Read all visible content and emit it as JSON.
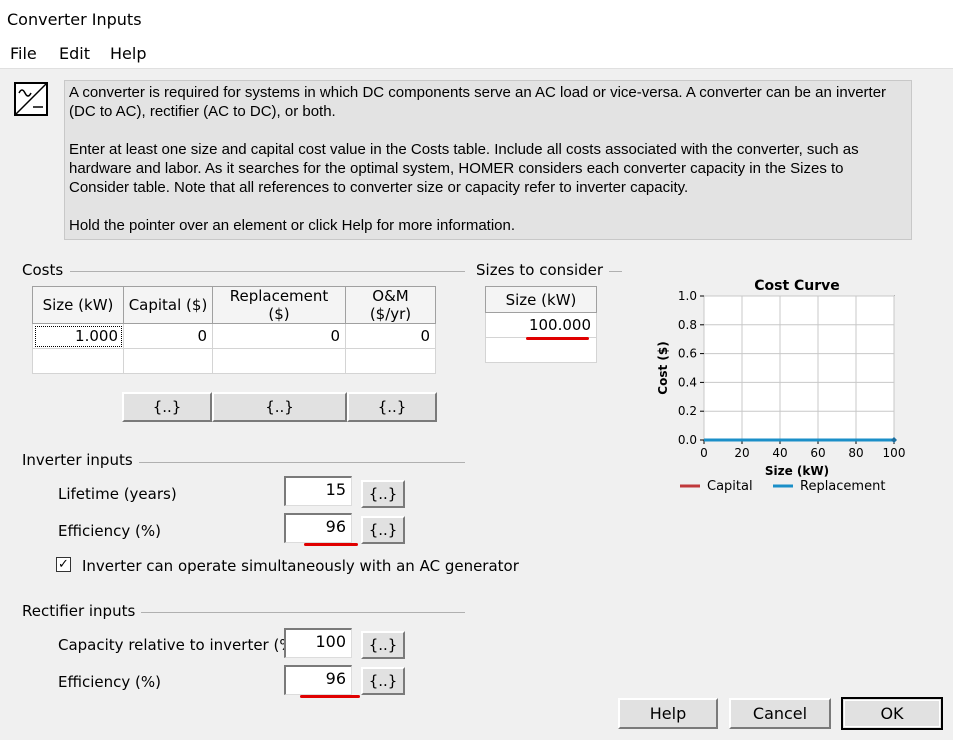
{
  "window": {
    "title": "Converter Inputs"
  },
  "menu": {
    "file": "File",
    "edit": "Edit",
    "help": "Help"
  },
  "info": {
    "p1": "A converter is required for systems in which DC components serve an AC load or vice-versa. A converter can be an inverter (DC to AC), rectifier (AC to DC), or both.",
    "p2": "Enter at least one size and capital cost value in the Costs table. Include all costs associated with the converter, such as hardware and labor. As it searches for the optimal system, HOMER considers each converter capacity in the Sizes to Consider table. Note that all references to converter size or capacity refer to inverter capacity.",
    "p3": "Hold the pointer over an element or click Help for more information."
  },
  "costs": {
    "label": "Costs",
    "headers": [
      "Size (kW)",
      "Capital ($)",
      "Replacement ($)",
      "O&M ($/yr)"
    ],
    "row": [
      "1.000",
      "0",
      "0",
      "0"
    ],
    "button": "{..}"
  },
  "sizes": {
    "label": "Sizes to consider",
    "header": "Size (kW)",
    "value": "100.000"
  },
  "inverter": {
    "label": "Inverter inputs",
    "lifetime_label": "Lifetime (years)",
    "lifetime_value": "15",
    "efficiency_label": "Efficiency (%)",
    "efficiency_value": "96",
    "button": "{..}",
    "checkbox_label": "Inverter can operate simultaneously with an AC generator",
    "checkbox_checked": true
  },
  "rectifier": {
    "label": "Rectifier inputs",
    "capacity_label": "Capacity relative to inverter (%)",
    "capacity_value": "100",
    "efficiency_label": "Efficiency (%)",
    "efficiency_value": "96",
    "button": "{..}"
  },
  "buttons": {
    "help": "Help",
    "cancel": "Cancel",
    "ok": "OK"
  },
  "colors": {
    "capital": "#c0393b",
    "replacement": "#1b8fc8",
    "highlight": "#e00000"
  },
  "chart_data": {
    "type": "line",
    "title": "Cost Curve",
    "xlabel": "Size (kW)",
    "ylabel": "Cost ($)",
    "xlim": [
      0,
      100
    ],
    "ylim": [
      0,
      1.0
    ],
    "xticks": [
      "0",
      "20",
      "40",
      "60",
      "80",
      "100"
    ],
    "yticks": [
      "0.0",
      "0.2",
      "0.4",
      "0.6",
      "0.8",
      "1.0"
    ],
    "grid": true,
    "legend_position": "bottom",
    "series": [
      {
        "name": "Capital",
        "x": [
          0,
          100
        ],
        "y": [
          0,
          0
        ]
      },
      {
        "name": "Replacement",
        "x": [
          0,
          100
        ],
        "y": [
          0,
          0
        ]
      }
    ]
  }
}
